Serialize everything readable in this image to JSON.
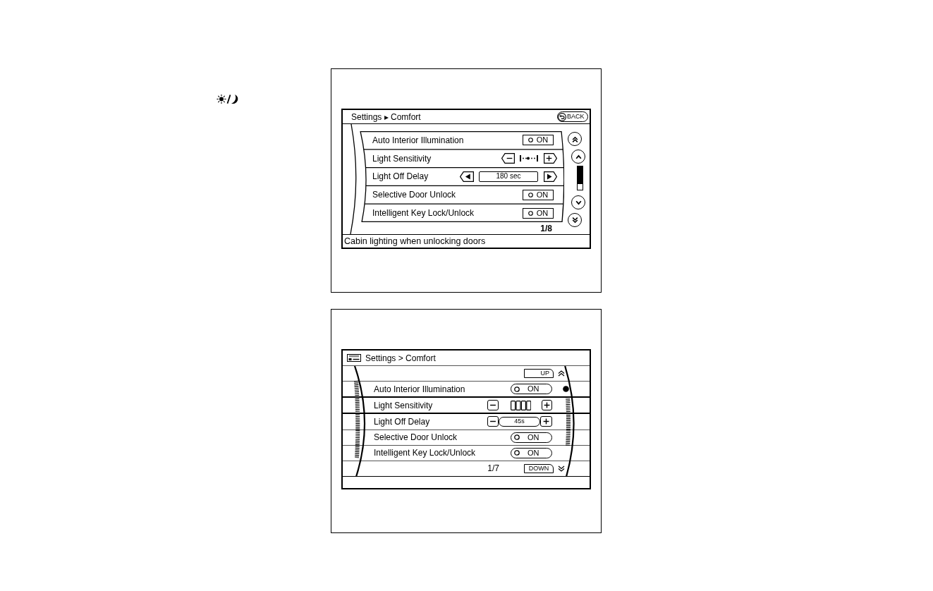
{
  "upper_screen": {
    "breadcrumb": "Settings ▸ Comfort",
    "back_button": "BACK",
    "rows": [
      {
        "kind": "toggle",
        "label": "Auto Interior Illumination",
        "value": "ON",
        "on": false
      },
      {
        "kind": "level",
        "label": "Light Sensitivity",
        "level": 0.45
      },
      {
        "kind": "select",
        "label": "Light Off Delay",
        "value": "180 sec"
      },
      {
        "kind": "toggle",
        "label": "Selective Door Unlock",
        "value": "ON",
        "on": false
      },
      {
        "kind": "toggle",
        "label": "Intelligent Key Lock/Unlock",
        "value": "ON",
        "on": false
      }
    ],
    "page": "1/8",
    "status": "Cabin lighting when unlocking doors"
  },
  "lower_screen": {
    "breadcrumb": "Settings > Comfort",
    "up_button": "UP",
    "rows": [
      {
        "kind": "toggle",
        "label": "Auto Interior Illumination",
        "value": "ON",
        "on": false,
        "selected": false
      },
      {
        "kind": "meter",
        "label": "Light Sensitivity",
        "selected": true
      },
      {
        "kind": "select",
        "label": "Light Off Delay",
        "value": "45s",
        "selected": false
      },
      {
        "kind": "toggle",
        "label": "Selective Door Unlock",
        "value": "ON",
        "on": false,
        "selected": false
      },
      {
        "kind": "toggle",
        "label": "Intelligent Key Lock/Unlock",
        "value": "ON",
        "on": false,
        "selected": false
      }
    ],
    "page": "1/7",
    "down_button": "DOWN"
  }
}
